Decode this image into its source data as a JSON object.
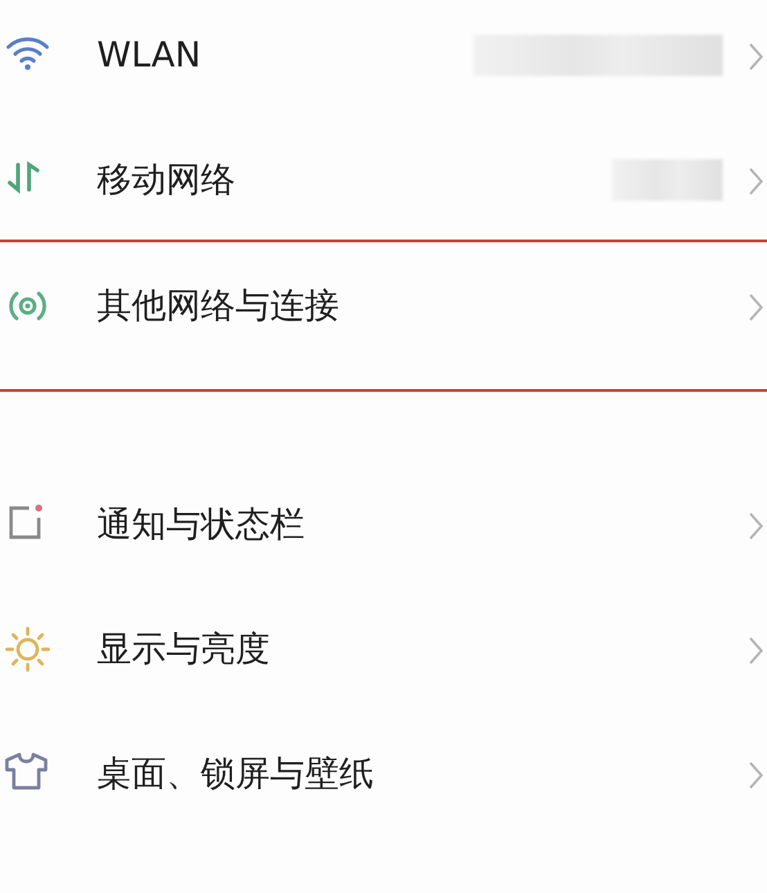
{
  "groups": [
    {
      "rows": [
        {
          "kind": "wifi",
          "label": "WLAN",
          "redacted": true,
          "highlighted": false
        },
        {
          "kind": "mobile",
          "label": "移动网络",
          "redacted": true,
          "highlighted": false
        },
        {
          "kind": "connect",
          "label": "其他网络与连接",
          "highlighted": true
        }
      ]
    },
    {
      "rows": [
        {
          "kind": "notify",
          "label": "通知与状态栏",
          "highlighted": false
        },
        {
          "kind": "display",
          "label": "显示与亮度",
          "highlighted": false
        },
        {
          "kind": "wallpaper",
          "label": "桌面、锁屏与壁纸",
          "highlighted": false
        }
      ]
    }
  ]
}
